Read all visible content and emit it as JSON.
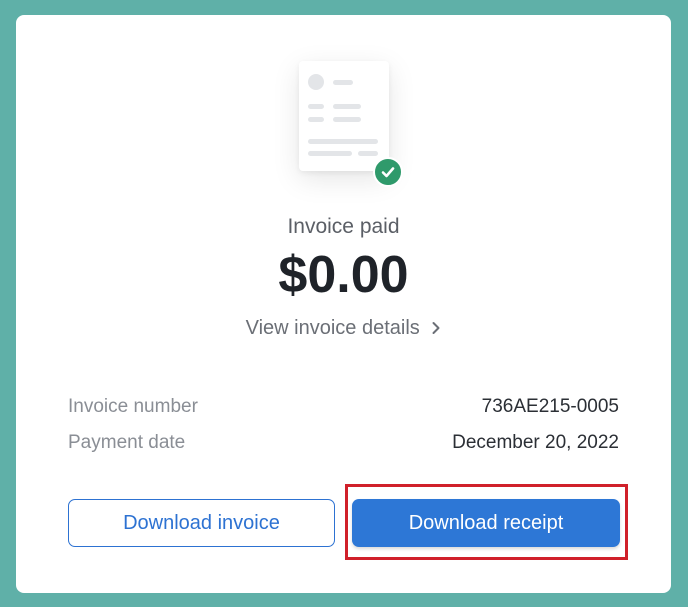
{
  "colors": {
    "background": "#5fb0a8",
    "card": "#ffffff",
    "accent": "#2d77d6",
    "success": "#2f9a6b",
    "highlight": "#d0202a"
  },
  "illustration": {
    "document_icon": "invoice-document-icon",
    "badge_icon": "checkmark-icon"
  },
  "invoice": {
    "status": "Invoice paid",
    "amount": "$0.00",
    "details_link": "View invoice details"
  },
  "info": [
    {
      "label": "Invoice number",
      "value": "736AE215-0005"
    },
    {
      "label": "Payment date",
      "value": "December 20, 2022"
    }
  ],
  "actions": {
    "download_invoice": "Download invoice",
    "download_receipt": "Download receipt"
  }
}
